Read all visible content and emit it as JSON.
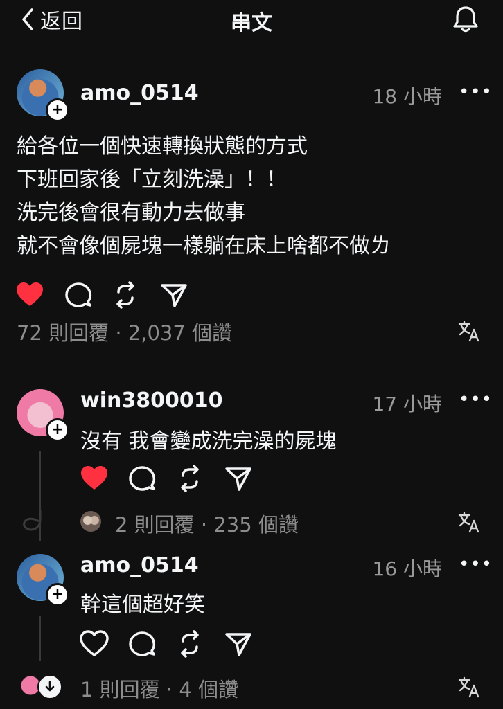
{
  "header": {
    "back_label": "返回",
    "title": "串文"
  },
  "post": {
    "username": "amo_0514",
    "time": "18 小時",
    "lines": [
      "給各位一個快速轉換狀態的方式",
      "下班回家後「立刻洗澡」！！",
      "洗完後會很有動力去做事",
      "就不會像個屍塊一樣躺在床上啥都不做ㄌ"
    ],
    "liked": true,
    "stats": "72 則回覆 · 2,037 個讚"
  },
  "reply1": {
    "username": "win3800010",
    "time": "17 小時",
    "text": "沒有 我會變成洗完澡的屍塊",
    "liked": true,
    "stats": "2 則回覆 · 235 個讚"
  },
  "reply2": {
    "username": "amo_0514",
    "time": "16 小時",
    "text": "幹這個超好笑",
    "liked": false,
    "stats": "1 則回覆 · 4 個讚"
  },
  "colors": {
    "background": "#101010",
    "text": "#f3f5f7",
    "muted": "#8d8d8d",
    "like_red": "#ff3040"
  },
  "icons": [
    "chevron-left-icon",
    "bell-icon",
    "heart-icon",
    "comment-icon",
    "repost-icon",
    "share-icon",
    "translate-icon",
    "more-icon",
    "plus-icon"
  ]
}
